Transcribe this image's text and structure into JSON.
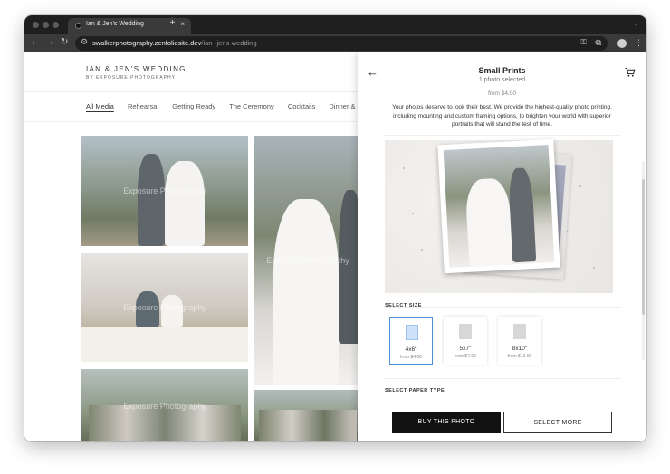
{
  "browser": {
    "tab_title": "Ian & Jen's Wedding",
    "tab_close_glyph": "×",
    "new_tab_glyph": "+",
    "url_host": "swalkerphotography.zenfoliosite.dev",
    "url_path": "/ian--jens-wedding"
  },
  "site": {
    "title": "IAN & JEN'S WEDDING",
    "subtitle": "BY EXPOSURE PHOTOGRAPHY",
    "nav": [
      "All Media",
      "Rehearsal",
      "Getting Ready",
      "The Ceremony",
      "Cocktails",
      "Dinner & D"
    ],
    "watermark": "Exposure Photography"
  },
  "panel": {
    "title": "Small Prints",
    "subtitle": "1 photo selected",
    "price": "from $4.00",
    "description": "Your photos deserve to look their best. We provide the highest-quality photo printing, including mounting and custom framing options, to brighten your world with superior portraits that will stand the test of time.",
    "select_size_label": "SELECT SIZE",
    "sizes": [
      {
        "name": "4x6\"",
        "price": "from $4.00",
        "selected": true
      },
      {
        "name": "5x7\"",
        "price": "from $7.00",
        "selected": false
      },
      {
        "name": "8x10\"",
        "price": "from $12.00",
        "selected": false
      }
    ],
    "paper_type_label": "SELECT PAPER TYPE",
    "buy_label": "BUY THIS PHOTO",
    "more_label": "SELECT MORE"
  },
  "colors": {
    "accent": "#4d8fd6",
    "button_dark": "#111111",
    "chrome_dark": "#1f1f1f"
  },
  "icons": [
    "back-arrow-icon",
    "cart-icon",
    "reload-icon",
    "star-icon",
    "extensions-icon",
    "menu-icon"
  ]
}
